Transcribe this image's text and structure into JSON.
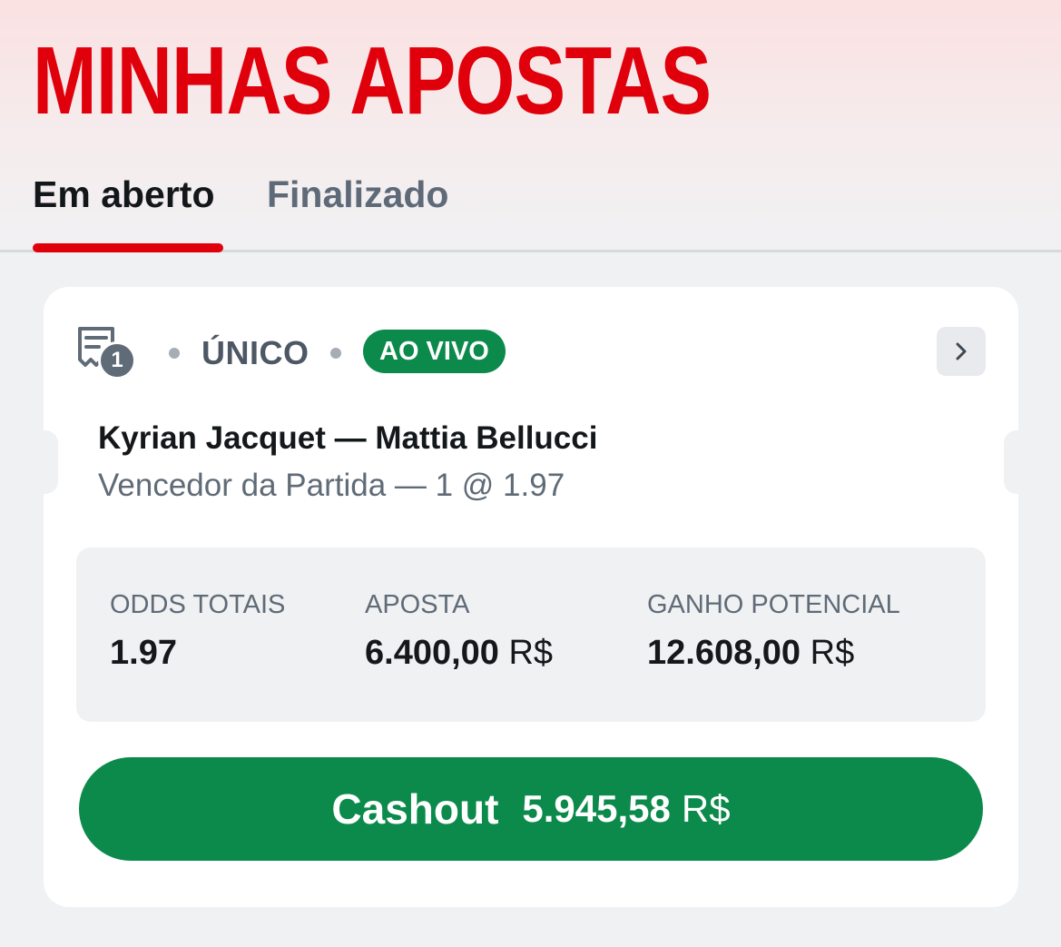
{
  "header": {
    "title": "MINHAS APOSTAS",
    "tabs": [
      {
        "label": "Em aberto",
        "active": true
      },
      {
        "label": "Finalizado",
        "active": false
      }
    ]
  },
  "bet_card": {
    "selection_count": "1",
    "bet_type": "ÚNICO",
    "live_badge": "AO VIVO",
    "match": "Kyrian Jacquet — Mattia Bellucci",
    "market": "Vencedor da Partida — 1 @ 1.97",
    "summary": {
      "odds": {
        "label": "ODDS TOTAIS",
        "value": "1.97"
      },
      "stake": {
        "label": "APOSTA",
        "value": "6.400,00",
        "currency": "R$"
      },
      "potential_win": {
        "label": "GANHO POTENCIAL",
        "value": "12.608,00",
        "currency": "R$"
      }
    },
    "cashout": {
      "label": "Cashout",
      "amount": "5.945,58",
      "currency": "R$"
    }
  },
  "colors": {
    "brand_red": "#e0000b",
    "live_green": "#0b8a4b",
    "text_dark": "#15181b",
    "text_muted": "#5f6b77"
  },
  "icons": [
    "ticket-icon",
    "chevron-right-icon"
  ]
}
